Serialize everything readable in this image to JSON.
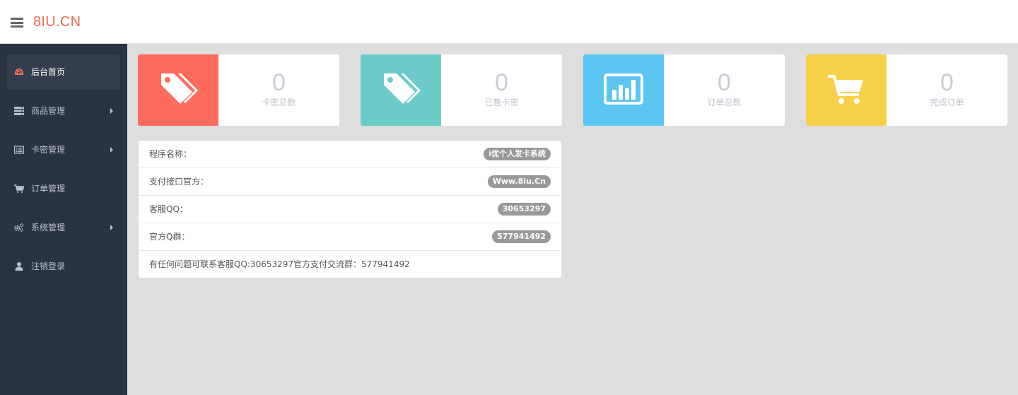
{
  "header": {
    "brand": "8IU.CN",
    "menu_icon": "hamburger-menu-icon"
  },
  "sidebar": {
    "items": [
      {
        "label": "后台首页",
        "icon": "dashboard-icon",
        "active": true,
        "has_submenu": false
      },
      {
        "label": "商品管理",
        "icon": "products-icon",
        "active": false,
        "has_submenu": true
      },
      {
        "label": "卡密管理",
        "icon": "card-list-icon",
        "active": false,
        "has_submenu": true
      },
      {
        "label": "订单管理",
        "icon": "cart-icon",
        "active": false,
        "has_submenu": false
      },
      {
        "label": "系统管理",
        "icon": "cogs-icon",
        "active": false,
        "has_submenu": true
      },
      {
        "label": "注销登录",
        "icon": "user-icon",
        "active": false,
        "has_submenu": false
      }
    ]
  },
  "stats": [
    {
      "value": "0",
      "label": "卡密总数",
      "color": "#ff6c5e",
      "icon": "tags-icon"
    },
    {
      "value": "0",
      "label": "已售卡密",
      "color": "#6ccbc9",
      "icon": "tags-icon"
    },
    {
      "value": "0",
      "label": "订单总数",
      "color": "#5bc6f1",
      "icon": "bar-chart-icon"
    },
    {
      "value": "0",
      "label": "完成订单",
      "color": "#f7d04a",
      "icon": "shopping-cart-icon"
    }
  ],
  "info": {
    "rows": [
      {
        "label": "程序名称：",
        "badge": "i优个人发卡系统"
      },
      {
        "label": "支付接口官方：",
        "badge": "Www.8iu.Cn"
      },
      {
        "label": "客服QQ：",
        "badge": "30653297"
      },
      {
        "label": "官方Q群：",
        "badge": "577941492"
      }
    ],
    "note": "有任何问题可联系客服QQ:30653297官方支付交流群：577941492"
  }
}
